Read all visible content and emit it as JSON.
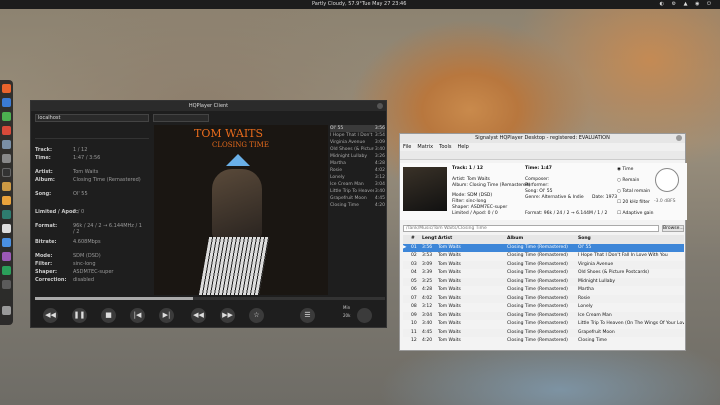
{
  "desktop": {
    "weather": "Partly Cloudy, 57.9°",
    "clock": "Tue May 27  23:46"
  },
  "hqplayer": {
    "window_title": "HQPlayer Client",
    "host": "localhost",
    "track": "1 / 12",
    "time": "1:47 / 3:56",
    "artist": "Tom Waits",
    "album": "Closing Time (Remastered)",
    "song": "Ol' 55",
    "limited_apod": "0 / 0",
    "format": "96k / 24 / 2 → 6.144MHz / 1 / 2",
    "bitrate": "4.608Mbps",
    "mode": "SDM (DSD)",
    "filter": "sinc-long",
    "shaper": "ASDM7EC-super",
    "correction": "disabled",
    "labels": {
      "track": "Track:",
      "time": "Time:",
      "artist": "Artist:",
      "album": "Album:",
      "song": "Song:",
      "limited": "Limited / Apod:",
      "format": "Format:",
      "bitrate": "Bitrate:",
      "mode": "Mode:",
      "filter": "Filter:",
      "shaper": "Shaper:",
      "correction": "Correction:"
    },
    "art_title": "TOM WAITS",
    "art_subtitle": "CLOSING TIME",
    "playlist": [
      {
        "title": "Ol' 55",
        "dur": "3:56"
      },
      {
        "title": "I Hope That I Don't Fall In Love With You",
        "dur": "3:54"
      },
      {
        "title": "Virginia Avenue",
        "dur": "3:09"
      },
      {
        "title": "Old Shoes (& Picture Postcards)",
        "dur": "3:40"
      },
      {
        "title": "Midnight Lullaby",
        "dur": "3:26"
      },
      {
        "title": "Martha",
        "dur": "4:28"
      },
      {
        "title": "Rosie",
        "dur": "4:02"
      },
      {
        "title": "Lonely",
        "dur": "3:12"
      },
      {
        "title": "Ice Cream Man",
        "dur": "3:04"
      },
      {
        "title": "Little Trip To Heaven (On The Wings Of Your Love)",
        "dur": "3:40"
      },
      {
        "title": "Grapefruit Moon",
        "dur": "4:45"
      },
      {
        "title": "Closing Time",
        "dur": "4:20"
      }
    ],
    "progress": 0.45,
    "volume_labels": [
      "Min",
      "20k"
    ],
    "controls": {
      "back": "◀◀",
      "play": "▶",
      "pause": "❚❚",
      "stop": "■",
      "prev": "|◀",
      "next": "▶|",
      "rew": "◀◀",
      "ff": "▶▶",
      "fav": "☆",
      "menu": "☰"
    }
  },
  "signalyst": {
    "window_title": "Signalyst HQPlayer Desktop - registered: EVALUATION",
    "menu": [
      "File",
      "Matrix",
      "Tools",
      "Help"
    ],
    "track_label": "Track: 1 / 12",
    "time_label": "Time: 1:47",
    "artist": "Artist: Tom Waits",
    "album": "Album: Closing Time (Remastered)",
    "composer": "Composer:",
    "performer": "Performer:",
    "song": "Song: Ol' 55",
    "genre": "Genre: Alternative & Indie",
    "date": "Date: 1973",
    "mode": "Mode: SDM (DSD)",
    "filter": "Filter: sinc-long",
    "shaper": "Shaper: ASDM7EC-super",
    "limited": "Limited / Apod: 0 / 0",
    "format": "Format: 96k / 24 / 2 → 6.144M / 1 / 2",
    "options": [
      "Time",
      "Remain",
      "Total remain",
      "20 kHz filter",
      "Adaptive gain"
    ],
    "dial_value": "-3.0 dBFS",
    "path": "/Tank/Music/Tom Waits/Closing Time",
    "browse": "Browse...",
    "columns": [
      "#",
      "Length",
      "Artist",
      "Album",
      "Song"
    ],
    "rows": [
      [
        "01",
        "3:56",
        "Tom Waits",
        "Closing Time (Remastered)",
        "Ol' 55"
      ],
      [
        "02",
        "3:53",
        "Tom Waits",
        "Closing Time (Remastered)",
        "I Hope That I Don't Fall In Love With You"
      ],
      [
        "03",
        "3:09",
        "Tom Waits",
        "Closing Time (Remastered)",
        "Virginia Avenue"
      ],
      [
        "04",
        "3:39",
        "Tom Waits",
        "Closing Time (Remastered)",
        "Old Shoes (& Picture Postcards)"
      ],
      [
        "05",
        "3:25",
        "Tom Waits",
        "Closing Time (Remastered)",
        "Midnight Lullaby"
      ],
      [
        "06",
        "4:28",
        "Tom Waits",
        "Closing Time (Remastered)",
        "Martha"
      ],
      [
        "07",
        "4:02",
        "Tom Waits",
        "Closing Time (Remastered)",
        "Rosie"
      ],
      [
        "08",
        "3:12",
        "Tom Waits",
        "Closing Time (Remastered)",
        "Lonely"
      ],
      [
        "09",
        "3:04",
        "Tom Waits",
        "Closing Time (Remastered)",
        "Ice Cream Man"
      ],
      [
        "10",
        "3:40",
        "Tom Waits",
        "Closing Time (Remastered)",
        "Little Trip To Heaven (On The Wings Of Your Love)"
      ],
      [
        "11",
        "4:45",
        "Tom Waits",
        "Closing Time (Remastered)",
        "Grapefruit Moon"
      ],
      [
        "12",
        "4:20",
        "Tom Waits",
        "Closing Time (Remastered)",
        "Closing Time"
      ]
    ],
    "accent": "#3d86d8"
  }
}
